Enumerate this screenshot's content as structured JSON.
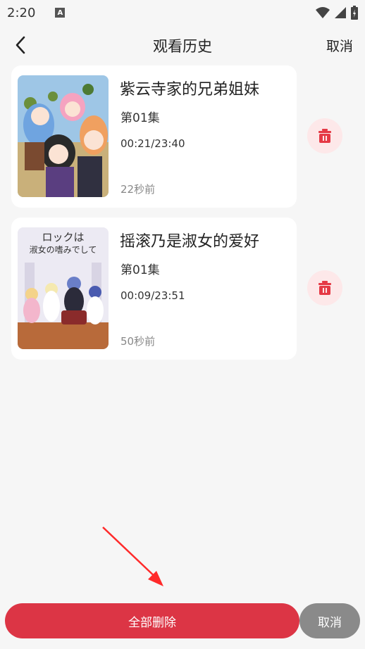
{
  "status": {
    "time": "2:20",
    "notif_glyph": "A"
  },
  "header": {
    "title": "观看历史",
    "cancel_label": "取消"
  },
  "history": [
    {
      "title": "紫云寺家的兄弟姐妹",
      "episode": "第01集",
      "progress": "00:21/23:40",
      "time_ago": "22秒前"
    },
    {
      "title": "摇滚乃是淑女的爱好",
      "episode": "第01集",
      "progress": "00:09/23:51",
      "time_ago": "50秒前"
    }
  ],
  "poster2_text": {
    "line1": "ロックは",
    "line2": "淑女の嗜みでして"
  },
  "footer": {
    "delete_all_label": "全部删除",
    "cancel_label": "取消"
  },
  "colors": {
    "accent": "#dc3545",
    "delete_bg": "#fde8e9",
    "cancel_bg": "#8a8a8a",
    "annotation_arrow": "#ff2a2a"
  },
  "icons": {
    "back": "chevron-left-icon",
    "delete": "trash-icon",
    "wifi": "wifi-icon",
    "signal": "signal-icon",
    "battery": "battery-icon"
  }
}
